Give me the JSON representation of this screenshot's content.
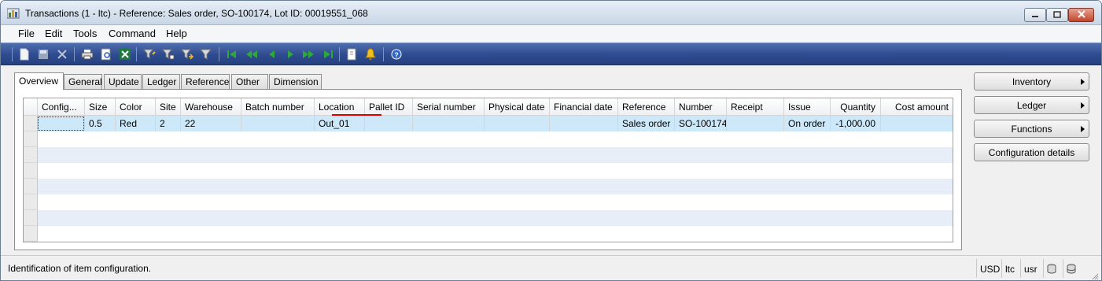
{
  "window": {
    "title": "Transactions (1 - ltc) - Reference: Sales order, SO-100174, Lot ID: 00019551_068"
  },
  "menu": [
    "File",
    "Edit",
    "Tools",
    "Command",
    "Help"
  ],
  "toolbar": {
    "icons": [
      "new-icon",
      "save-icon",
      "delete-icon",
      "print-icon",
      "print-preview-icon",
      "export-excel-icon",
      "filter-by-selection-icon",
      "filter-by-grid-icon",
      "advanced-filter-icon",
      "clear-filter-icon",
      "first-record-icon",
      "previous-page-icon",
      "previous-record-icon",
      "next-record-icon",
      "next-page-icon",
      "last-record-icon",
      "attachments-icon",
      "alerts-icon",
      "help-icon"
    ]
  },
  "tabs": [
    "Overview",
    "General",
    "Update",
    "Ledger",
    "Reference",
    "Other",
    "Dimension"
  ],
  "grid": {
    "columns": [
      "Config...",
      "Size",
      "Color",
      "Site",
      "Warehouse",
      "Batch number",
      "Location",
      "Pallet ID",
      "Serial number",
      "Physical date",
      "Financial date",
      "Reference",
      "Number",
      "Receipt",
      "Issue",
      "Quantity",
      "Cost amount"
    ],
    "rows": [
      [
        "",
        "0.5",
        "Red",
        "2",
        "22",
        "",
        "Out_01",
        "",
        "",
        "",
        "",
        "Sales order",
        "SO-100174",
        "",
        "On order",
        "-1,000.00",
        ""
      ]
    ]
  },
  "side_buttons": {
    "inventory": "Inventory",
    "ledger": "Ledger",
    "functions": "Functions",
    "configuration_details": "Configuration details"
  },
  "status": {
    "message": "Identification of item configuration.",
    "currency": "USD",
    "company": "ltc",
    "user": "usr"
  },
  "colors": {
    "toolbar": "#2e4b8f",
    "selected_row": "#cce8f9",
    "alt_row": "#e8eef8",
    "highlight_underline": "#e00000"
  }
}
